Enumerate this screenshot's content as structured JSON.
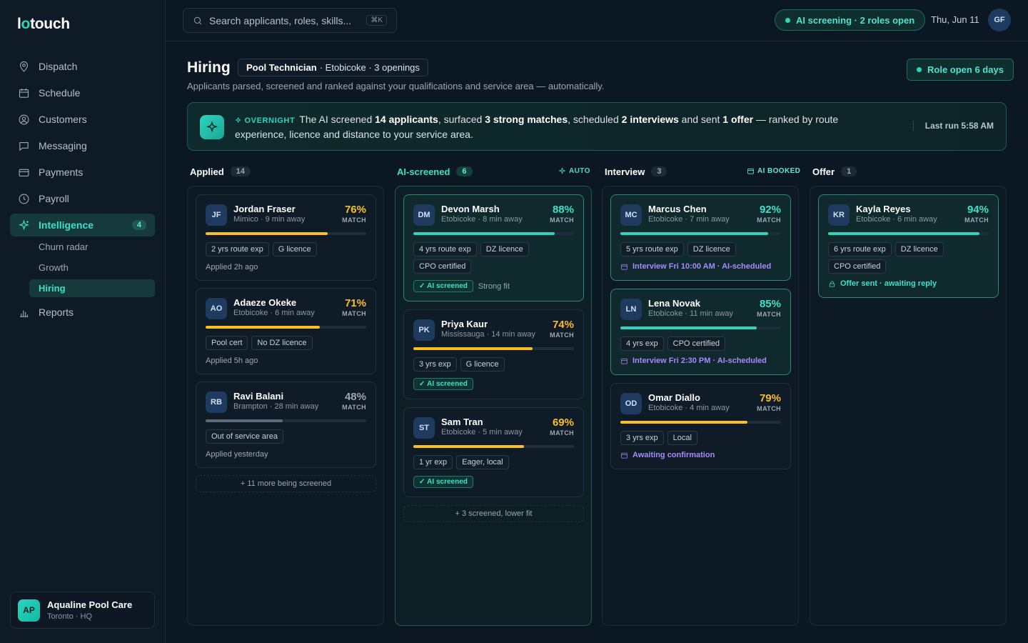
{
  "app": {
    "logo": "lotouch"
  },
  "sidebar": {
    "items": [
      {
        "label": "Dispatch",
        "icon": "pin-icon"
      },
      {
        "label": "Schedule",
        "icon": "calendar-icon"
      },
      {
        "label": "Customers",
        "icon": "user-circle-icon"
      },
      {
        "label": "Messaging",
        "icon": "chat-icon"
      },
      {
        "label": "Payments",
        "icon": "card-icon"
      },
      {
        "label": "Payroll",
        "icon": "clock-icon"
      },
      {
        "label": "Intelligence",
        "icon": "sparkle-icon",
        "badge": "4",
        "active": true
      },
      {
        "label": "Reports",
        "icon": "bar-chart-icon"
      }
    ],
    "subitems": [
      "Churn radar",
      "Growth",
      "Hiring"
    ],
    "active_sub": "Hiring",
    "org": {
      "initials": "AP",
      "name": "Aqualine Pool Care",
      "location": "Toronto · HQ"
    }
  },
  "topbar": {
    "search_placeholder": "Search applicants, roles, skills...",
    "shortcut": "⌘K",
    "ai_status": "AI screening · 2 roles open",
    "date": "Thu, Jun 11",
    "user_initials": "GF"
  },
  "header": {
    "title": "Hiring",
    "role": "Pool Technician",
    "role_detail": "· Etobicoke · 3 openings",
    "subtitle": "Applicants parsed, screened and ranked against your qualifications and service area — automatically.",
    "role_open": "Role open 6 days"
  },
  "banner": {
    "tag": "OVERNIGHT",
    "t1": "The AI screened ",
    "b1": "14 applicants",
    "t2": ", surfaced ",
    "b2": "3 strong matches",
    "t3": ", scheduled ",
    "b3": "2 interviews",
    "t4": " and sent ",
    "b4": "1 offer",
    "t5": " — ranked by route experience, licence and distance to your service area.",
    "last_run": "Last run 5:58 AM"
  },
  "columns": {
    "applied": {
      "title": "Applied",
      "count": "14",
      "more": "+ 11 more being screened"
    },
    "screened": {
      "title": "AI-screened",
      "count": "6",
      "tag": "AUTO",
      "more": "+ 3 screened, lower fit"
    },
    "interview": {
      "title": "Interview",
      "count": "3",
      "tag": "AI BOOKED"
    },
    "offer": {
      "title": "Offer",
      "count": "1"
    }
  },
  "match_label": "MATCH",
  "screened_label": "AI screened",
  "cards": {
    "jf": {
      "initials": "JF",
      "name": "Jordan Fraser",
      "meta": "Mimico · 9 min away",
      "pct": "76%",
      "match": 0.76,
      "chips": [
        "2 yrs route exp",
        "G licence"
      ],
      "foot": "Applied 2h ago"
    },
    "ao": {
      "initials": "AO",
      "name": "Adaeze Okeke",
      "meta": "Etobicoke · 6 min away",
      "pct": "71%",
      "match": 0.71,
      "chips": [
        "Pool cert",
        "No DZ licence"
      ],
      "foot": "Applied 5h ago"
    },
    "rb": {
      "initials": "RB",
      "name": "Ravi Balani",
      "meta": "Brampton · 28 min away",
      "pct": "48%",
      "match": 0.48,
      "chips": [
        "Out of service area"
      ],
      "foot": "Applied yesterday"
    },
    "dm": {
      "initials": "DM",
      "name": "Devon Marsh",
      "meta": "Etobicoke · 8 min away",
      "pct": "88%",
      "match": 0.88,
      "chips": [
        "4 yrs route exp",
        "DZ licence",
        "CPO certified"
      ],
      "note": "Strong fit"
    },
    "pk": {
      "initials": "PK",
      "name": "Priya Kaur",
      "meta": "Mississauga · 14 min away",
      "pct": "74%",
      "match": 0.74,
      "chips": [
        "3 yrs exp",
        "G licence"
      ]
    },
    "st": {
      "initials": "ST",
      "name": "Sam Tran",
      "meta": "Etobicoke · 5 min away",
      "pct": "69%",
      "match": 0.69,
      "chips": [
        "1 yr exp",
        "Eager, local"
      ]
    },
    "mc": {
      "initials": "MC",
      "name": "Marcus Chen",
      "meta": "Etobicoke · 7 min away",
      "pct": "92%",
      "match": 0.92,
      "chips": [
        "5 yrs route exp",
        "DZ licence"
      ],
      "sched": "Interview Fri 10:00 AM · AI-scheduled"
    },
    "ln": {
      "initials": "LN",
      "name": "Lena Novak",
      "meta": "Etobicoke · 11 min away",
      "pct": "85%",
      "match": 0.85,
      "chips": [
        "4 yrs exp",
        "CPO certified"
      ],
      "sched": "Interview Fri 2:30 PM · AI-scheduled"
    },
    "od": {
      "initials": "OD",
      "name": "Omar Diallo",
      "meta": "Etobicoke · 4 min away",
      "pct": "79%",
      "match": 0.79,
      "chips": [
        "3 yrs exp",
        "Local"
      ],
      "sched": "Awaiting confirmation"
    },
    "kr": {
      "initials": "KR",
      "name": "Kayla Reyes",
      "meta": "Etobicoke · 6 min away",
      "pct": "94%",
      "match": 0.94,
      "chips": [
        "6 yrs route exp",
        "DZ licence",
        "CPO certified"
      ],
      "offer": "Offer sent · awaiting reply"
    }
  },
  "colors": {
    "teal": "#2dd4bf",
    "yellow": "#fbbf24",
    "grey": "#5b6a78",
    "purple": "#a78bfa"
  }
}
